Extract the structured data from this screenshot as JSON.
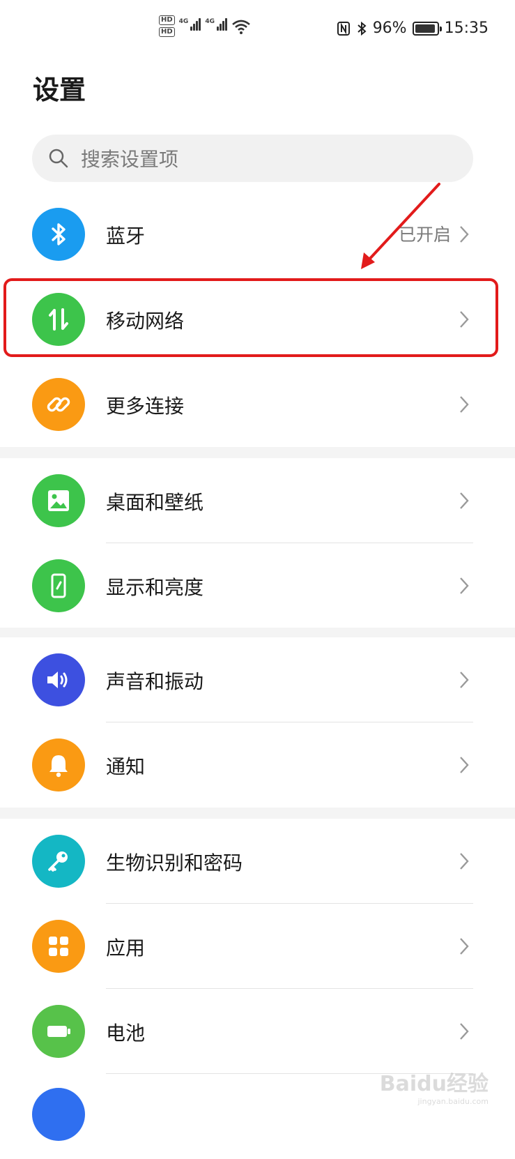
{
  "status_bar": {
    "hd1": "HD",
    "hd2": "HD",
    "sim1_tech": "4G",
    "sim2_tech": "4G",
    "battery_percent": "96%",
    "battery_level": 0.96,
    "time": "15:35"
  },
  "page": {
    "title": "设置"
  },
  "search": {
    "placeholder": "搜索设置项"
  },
  "sections": [
    {
      "items": [
        {
          "label": "蓝牙",
          "value": "已开启",
          "icon": "bluetooth-icon",
          "color": "#1a9cf0"
        },
        {
          "label": "移动网络",
          "icon": "mobile-data-icon",
          "color": "#3dc44b"
        },
        {
          "label": "更多连接",
          "icon": "link-icon",
          "color": "#fa9a13"
        }
      ]
    },
    {
      "items": [
        {
          "label": "桌面和壁纸",
          "icon": "wallpaper-icon",
          "color": "#3dc44b"
        },
        {
          "label": "显示和亮度",
          "icon": "display-icon",
          "color": "#3dc44b"
        }
      ]
    },
    {
      "items": [
        {
          "label": "声音和振动",
          "icon": "sound-icon",
          "color": "#3d50e0"
        },
        {
          "label": "通知",
          "icon": "bell-icon",
          "color": "#fa9a13"
        }
      ]
    },
    {
      "items": [
        {
          "label": "生物识别和密码",
          "icon": "key-icon",
          "color": "#14b7c4"
        },
        {
          "label": "应用",
          "icon": "apps-icon",
          "color": "#fa9a13"
        },
        {
          "label": "电池",
          "icon": "battery-icon",
          "color": "#57c24a"
        }
      ]
    }
  ],
  "watermark": {
    "text": "Baidu经验",
    "sub": "jingyan.baidu.com"
  },
  "annotation": {
    "highlight_color": "#e21b1b"
  }
}
